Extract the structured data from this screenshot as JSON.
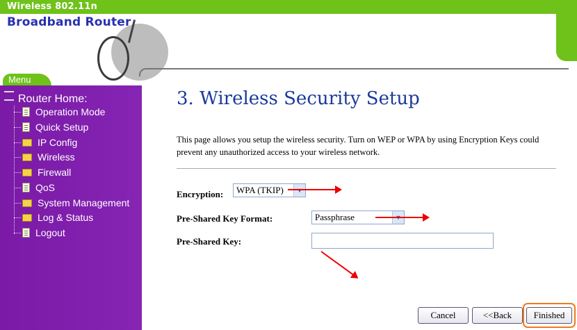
{
  "brand": {
    "line1": "Wireless 802.11n",
    "line2": "Broadband Router"
  },
  "menu_tab": "Menu",
  "sidebar": {
    "root": "Router Home:",
    "items": [
      {
        "label": "Operation Mode",
        "icon": "page-icon"
      },
      {
        "label": "Quick Setup",
        "icon": "page-icon"
      },
      {
        "label": "IP Config",
        "icon": "folder-icon"
      },
      {
        "label": "Wireless",
        "icon": "folder-icon"
      },
      {
        "label": "Firewall",
        "icon": "folder-icon"
      },
      {
        "label": "QoS",
        "icon": "page-icon"
      },
      {
        "label": "System Management",
        "icon": "folder-icon"
      },
      {
        "label": "Log & Status",
        "icon": "folder-icon"
      },
      {
        "label": "Logout",
        "icon": "page-icon"
      }
    ]
  },
  "main": {
    "title": "3. Wireless Security Setup",
    "description": "This page allows you setup the wireless security. Turn on WEP or WPA by using Encryption Keys could prevent any unauthorized access to your wireless network.",
    "encryption": {
      "label": "Encryption:",
      "value": "WPA (TKIP)"
    },
    "key_format": {
      "label": "Pre-Shared Key Format:",
      "value": "Passphrase"
    },
    "key": {
      "label": "Pre-Shared Key:",
      "value": ""
    }
  },
  "buttons": {
    "cancel": "Cancel",
    "back": "<<Back",
    "finished": "Finished"
  },
  "colors": {
    "brand_green": "#6ec21a",
    "sidebar_purple": "#7b1fa2",
    "title_blue": "#1a3a9a",
    "annotation_red": "#e00000",
    "highlight_orange": "#f07a1a"
  }
}
